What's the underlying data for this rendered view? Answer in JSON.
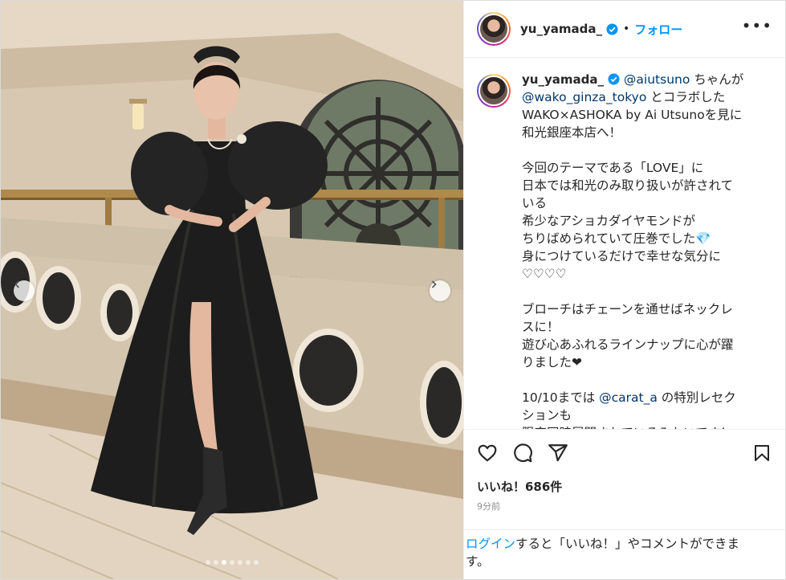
{
  "user": {
    "username": "yu_yamada_",
    "follow_label": "フォロー",
    "separator": "•"
  },
  "post": {
    "caption": {
      "mention1": "@aiutsuno",
      "text1": " ちゃんが\n",
      "mention2": "@wako_ginza_tokyo",
      "text2": " とコラボした\nWAKO×ASHOKA by Ai Utsunoを見に\n和光銀座本店へ！\n\n今回のテーマである「LOVE」に\n日本では和光のみ取り扱いが許されて\nいる\n希少なアショカダイヤモンドが\nちりばめられていて圧巻でした💎\n身につけているだけで幸せな気分に\n♡♡♡♡\n\nブローチはチェーンを通せばネックレ\nスに！\n遊び心あふれるラインナップに心が躍\nりました❤\n\n10/10までは ",
      "mention3": "@carat_a",
      "text3": " の特別レセク\nションも\n限定同時展開されているみたいです！"
    },
    "likes": "いいね！686件",
    "time": "9分前"
  },
  "carousel": {
    "count": 7,
    "active_index": 2
  },
  "login_prompt": {
    "link": "ログイン",
    "text": "すると「いいね！」やコメントができま\nす。"
  },
  "icons": {
    "verified": "verified-badge-icon",
    "more": "more-options-icon",
    "like": "heart-icon",
    "comment": "comment-icon",
    "share": "share-icon",
    "save": "bookmark-icon",
    "prev": "chevron-left-icon",
    "next": "chevron-right-icon"
  },
  "colors": {
    "accent": "#0095f6",
    "mention": "#00376b",
    "verified": "#0095f6",
    "muted": "#8e8e8e"
  }
}
